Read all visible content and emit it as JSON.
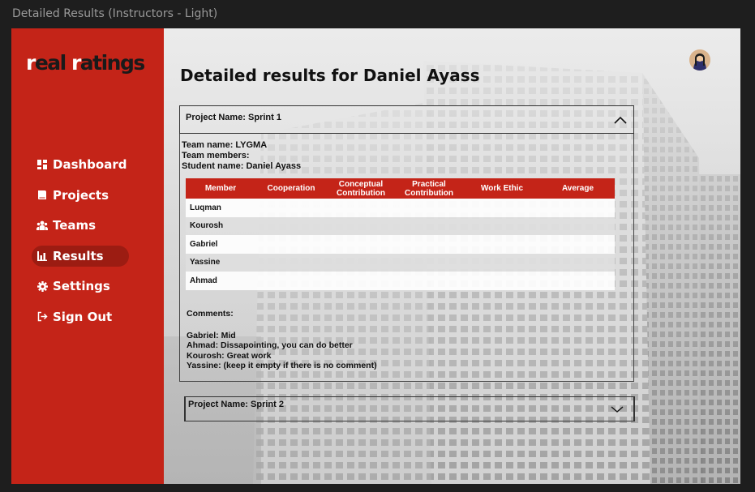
{
  "window": {
    "title": "Detailed Results (Instructors - Light)"
  },
  "brand": {
    "logo_text_parts": [
      "r",
      "eal ",
      "r",
      "atings"
    ]
  },
  "nav": [
    {
      "label": "Dashboard",
      "icon": "dashboard-icon",
      "active": false
    },
    {
      "label": "Projects",
      "icon": "book-icon",
      "active": false
    },
    {
      "label": "Teams",
      "icon": "people-icon",
      "active": false
    },
    {
      "label": "Results",
      "icon": "bar-chart-icon",
      "active": true
    },
    {
      "label": "Settings",
      "icon": "gear-icon",
      "active": false
    },
    {
      "label": "Sign Out",
      "icon": "sign-out-icon",
      "active": false
    }
  ],
  "page": {
    "title": "Detailed results for Daniel Ayass"
  },
  "project1": {
    "header": "Project Name: Sprint 1",
    "team_name": "Team name: LYGMA",
    "team_members": "Team members:",
    "student_name": "Student name: Daniel Ayass",
    "columns": [
      "Member",
      "Cooperation",
      "Conceptual Contribution",
      "Practical Contribution",
      "Work Ethic",
      "Average"
    ],
    "rows": [
      "Luqman",
      "Kourosh",
      "Gabriel",
      "Yassine",
      "Ahmad"
    ],
    "comments_label": "Comments:",
    "comments": [
      "Gabriel: Mid",
      "Ahmad: Dissapointing, you can do better",
      "Kourosh: Great work",
      "Yassine: (keep it empty if there is no comment)"
    ]
  },
  "project2": {
    "header": "Project Name: Sprint 2"
  },
  "colors": {
    "accent": "#c42418",
    "accent_dark": "#9c1c12"
  }
}
